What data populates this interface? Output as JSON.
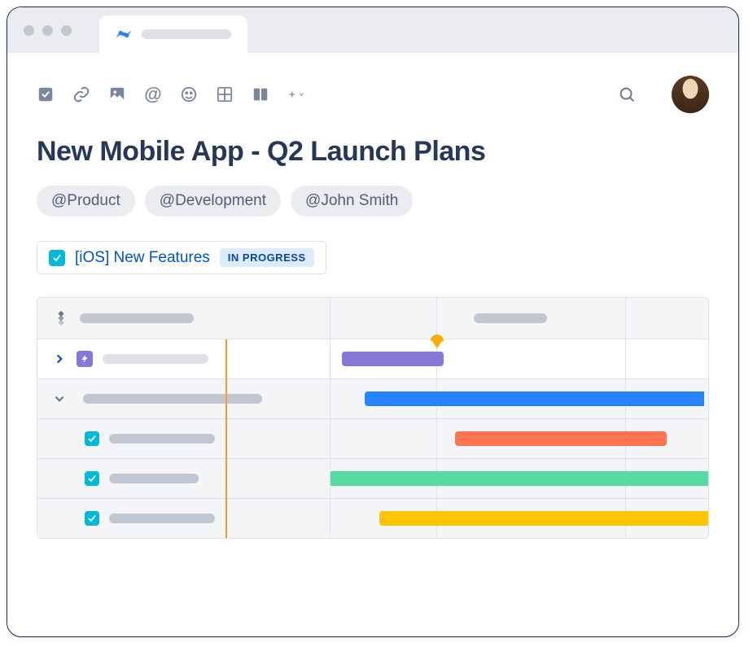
{
  "page": {
    "title": "New Mobile App - Q2 Launch Plans"
  },
  "mentions": [
    "@Product",
    "@Development",
    "@John Smith"
  ],
  "card": {
    "title": "[iOS] New Features",
    "status": "IN PROGRESS"
  },
  "gantt": {
    "colors": {
      "purple": "#8777D9",
      "blue": "#2684FF",
      "orange": "#FF7452",
      "green": "#57D9A3",
      "yellow": "#FFC400"
    }
  }
}
